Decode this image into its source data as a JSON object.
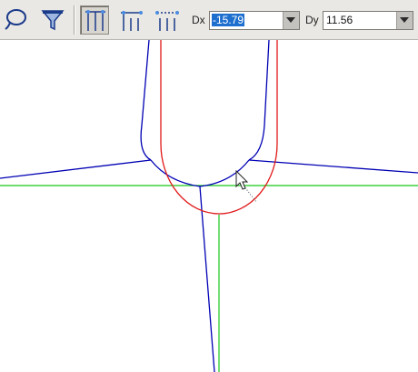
{
  "toolbar": {
    "tools": [
      {
        "icon": "lasso-select-icon"
      },
      {
        "icon": "filter-funnel-icon"
      },
      {
        "icon": "align-verticals-icon",
        "pressed": true
      },
      {
        "icon": "align-top-icon"
      },
      {
        "icon": "align-dots-icon"
      }
    ],
    "dx": {
      "label": "Dx",
      "value": "-15.79"
    },
    "dy": {
      "label": "Dy",
      "value": "11.56"
    }
  },
  "colors": {
    "wire": "#0000b4",
    "highlight": "#e01818",
    "guide": "#18c818",
    "toolbar_bg": "#eae8e4",
    "selection": "#1f6fcf"
  }
}
